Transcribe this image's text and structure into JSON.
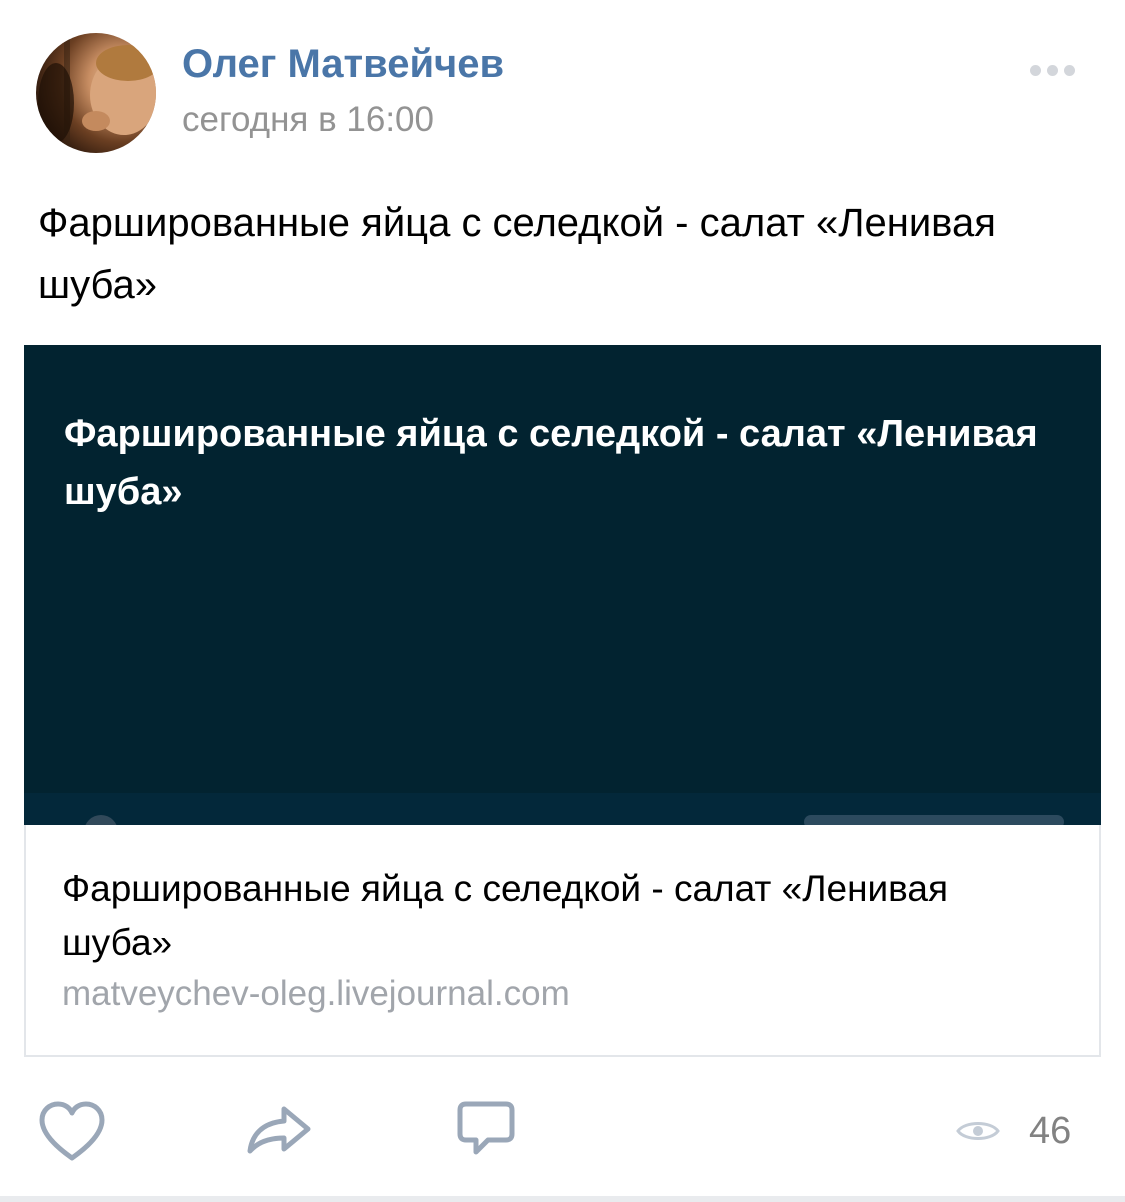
{
  "post": {
    "author_name": "Олег Матвейчев",
    "time": "сегодня в 16:00",
    "text": "Фаршированные яйца с селедкой - салат «Ленивая шуба»"
  },
  "link_card": {
    "image_title": "Фаршированные яйца с селедкой - салат «Ленивая шуба»",
    "title": "Фаршированные яйца с селедкой - салат «Ленивая шуба»",
    "domain": "matveychev-oleg.livejournal.com"
  },
  "footer": {
    "views_count": "46"
  },
  "colors": {
    "author_link": "#4a76a8",
    "card_image_bg": "#022330",
    "icon_gray": "#9aa7b8"
  },
  "icons": {
    "more": "more-icon",
    "like": "heart-icon",
    "share": "share-arrow-icon",
    "comment": "comment-bubble-icon",
    "views": "eye-icon"
  }
}
